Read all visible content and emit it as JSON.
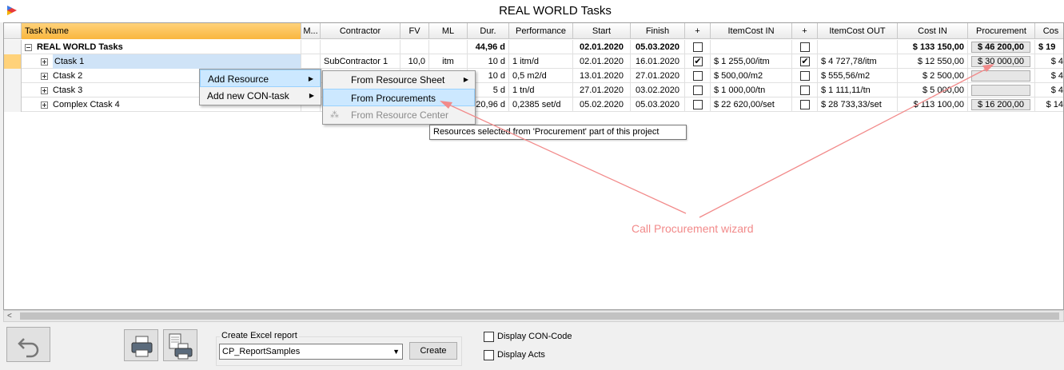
{
  "window": {
    "title": "REAL WORLD Tasks"
  },
  "columns": [
    "Task Name",
    "M...",
    "Contractor",
    "FV",
    "ML",
    "Dur.",
    "Performance",
    "Start",
    "Finish",
    "+",
    "ItemCost IN",
    "+",
    "ItemCost OUT",
    "Cost IN",
    "Procurement",
    "Cos"
  ],
  "rows": [
    {
      "name": "REAL WORLD Tasks",
      "contractor": "",
      "fv": "",
      "ml": "",
      "dur": "44,96 d",
      "perf": "",
      "start": "02.01.2020",
      "finish": "05.03.2020",
      "in_checked": false,
      "item_in": "",
      "out_checked": false,
      "item_out": "",
      "cost_in": "$ 133 150,00",
      "procurement": "$ 46 200,00",
      "cost": "$ 19"
    },
    {
      "name": "Ctask 1",
      "contractor": "SubContractor 1",
      "fv": "10,0",
      "ml": "itm",
      "dur": "10 d",
      "perf": "1 itm/d",
      "start": "02.01.2020",
      "finish": "16.01.2020",
      "in_checked": true,
      "item_in": "$ 1 255,00/itm",
      "out_checked": true,
      "item_out": "$ 4 727,78/itm",
      "cost_in": "$ 12 550,00",
      "procurement": "$ 30 000,00",
      "cost": "$ 4"
    },
    {
      "name": "Ctask 2",
      "contractor": "",
      "fv": "",
      "ml": "",
      "dur": "10 d",
      "perf": "0,5 m2/d",
      "start": "13.01.2020",
      "finish": "27.01.2020",
      "in_checked": false,
      "item_in": "$ 500,00/m2",
      "out_checked": false,
      "item_out": "$ 555,56/m2",
      "cost_in": "$ 2 500,00",
      "procurement": "",
      "cost": "$ 4"
    },
    {
      "name": "Ctask 3",
      "contractor": "",
      "fv": "",
      "ml": "",
      "dur": "5 d",
      "perf": "1 tn/d",
      "start": "27.01.2020",
      "finish": "03.02.2020",
      "in_checked": false,
      "item_in": "$ 1 000,00/tn",
      "out_checked": false,
      "item_out": "$ 1 111,11/tn",
      "cost_in": "$ 5 000,00",
      "procurement": "",
      "cost": "$ 4"
    },
    {
      "name": "Complex Ctask 4",
      "contractor": "",
      "fv": "",
      "ml": "",
      "dur": "20,96 d",
      "perf": "0,2385 set/d",
      "start": "05.02.2020",
      "finish": "05.03.2020",
      "in_checked": false,
      "item_in": "$ 22 620,00/set",
      "out_checked": false,
      "item_out": "$ 28 733,33/set",
      "cost_in": "$ 113 100,00",
      "procurement": "$ 16 200,00",
      "cost": "$ 14"
    }
  ],
  "context_menu": {
    "add_resource": "Add Resource",
    "add_con_task": "Add new CON-task"
  },
  "submenu": {
    "from_resource_sheet": "From Resource Sheet",
    "from_procurements": "From Procurements",
    "from_resource_center": "From Resource Center"
  },
  "tooltip": "Resources selected from 'Procurement' part of this project",
  "annotation": "Call Procurement wizard",
  "bottom": {
    "report_label": "Create Excel report",
    "report_value": "CP_ReportSamples",
    "create_label": "Create",
    "display_con_code": "Display CON-Code",
    "display_acts": "Display Acts"
  },
  "colors": {
    "header_selected": "#f9b63e",
    "menu_highlight": "#cce8ff",
    "annotation": "#f28a8a"
  }
}
